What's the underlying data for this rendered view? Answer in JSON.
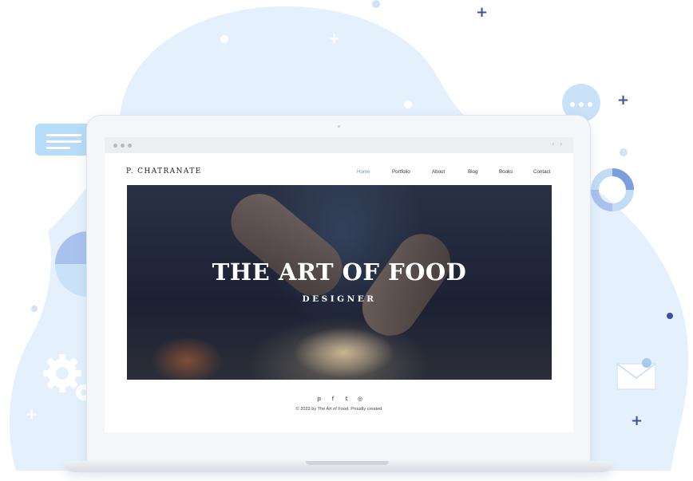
{
  "site": {
    "brand": "P. CHATRANATE",
    "nav": [
      "Home",
      "Portfolio",
      "About",
      "Blog",
      "Books",
      "Contact"
    ],
    "hero_title": "THE ART OF FOOD",
    "hero_subtitle": "DESIGNER",
    "social": {
      "pinterest": "𝕡",
      "facebook": "f",
      "twitter": "𝕥",
      "instagram": "◎"
    },
    "copyright": "© 2023 by The Art of Food. Proudly created"
  },
  "browser": {
    "back": "‹",
    "forward": "›"
  },
  "colors": {
    "accent": "#6a8fc5",
    "blob": "#e4f1fd",
    "plus": "#3c51a6"
  }
}
